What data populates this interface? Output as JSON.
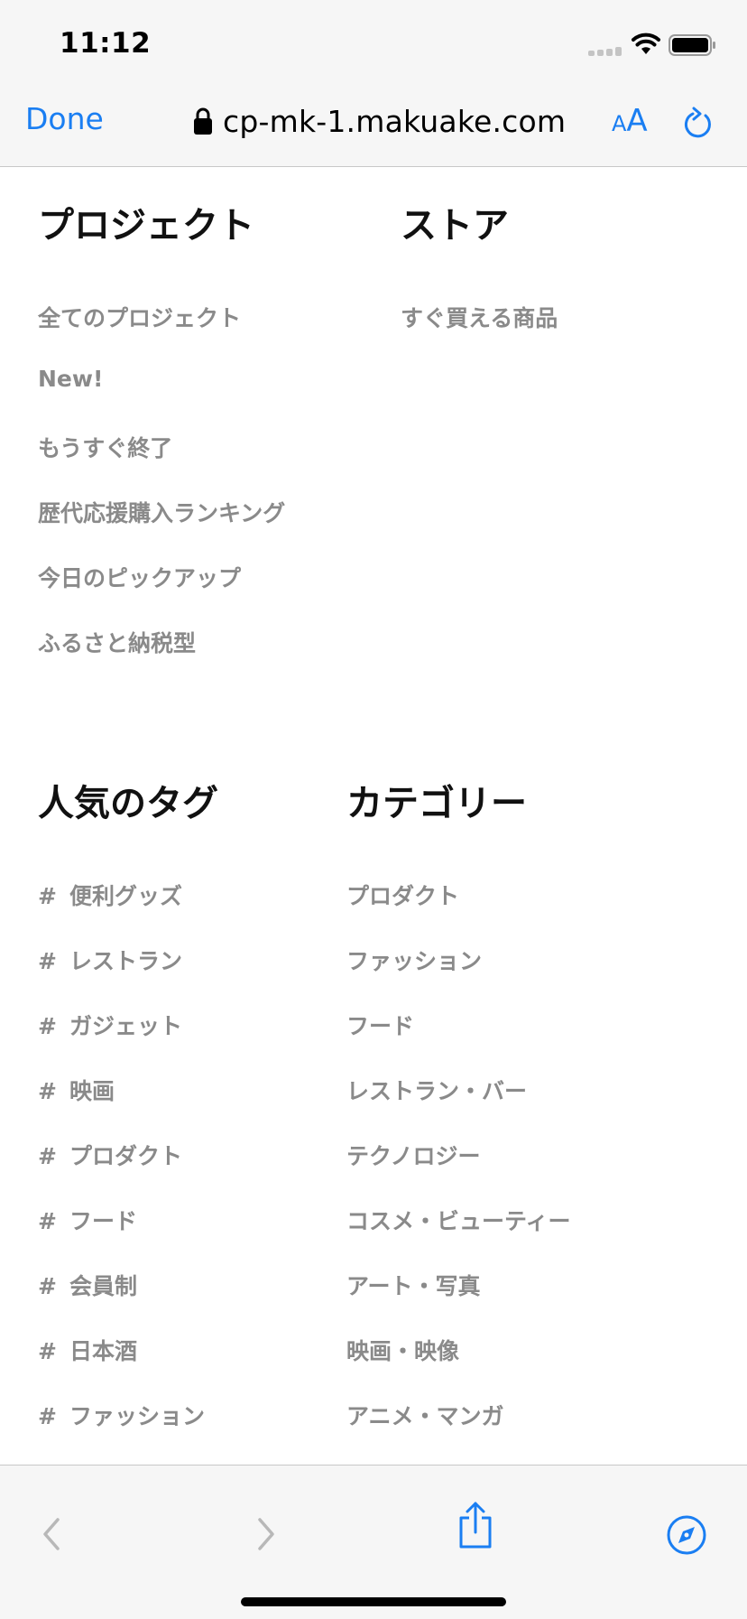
{
  "status_bar": {
    "time": "11:12"
  },
  "browser": {
    "done_label": "Done",
    "url": "cp-mk-1.makuake.com",
    "aa_small": "A",
    "aa_big": "A",
    "accent_color": "#1a7ef2"
  },
  "project": {
    "title": "プロジェクト",
    "items": [
      "全てのプロジェクト",
      "New!",
      "もうすぐ終了",
      "歴代応援購入ランキング",
      "今日のピックアップ",
      "ふるさと納税型"
    ]
  },
  "store": {
    "title": "ストア",
    "items": [
      "すぐ買える商品"
    ]
  },
  "tags": {
    "title": "人気のタグ",
    "hash": "#",
    "items": [
      "便利グッズ",
      "レストラン",
      "ガジェット",
      "映画",
      "プロダクト",
      "フード",
      "会員制",
      "日本酒",
      "ファッション"
    ]
  },
  "categories": {
    "title": "カテゴリー",
    "items": [
      "プロダクト",
      "ファッション",
      "フード",
      "レストラン・バー",
      "テクノロジー",
      "コスメ・ビューティー",
      "アート・写真",
      "映画・映像",
      "アニメ・マンガ"
    ]
  },
  "toolbar": {
    "icons": [
      "chevron-left-icon",
      "chevron-right-icon",
      "share-icon",
      "compass-icon"
    ]
  }
}
